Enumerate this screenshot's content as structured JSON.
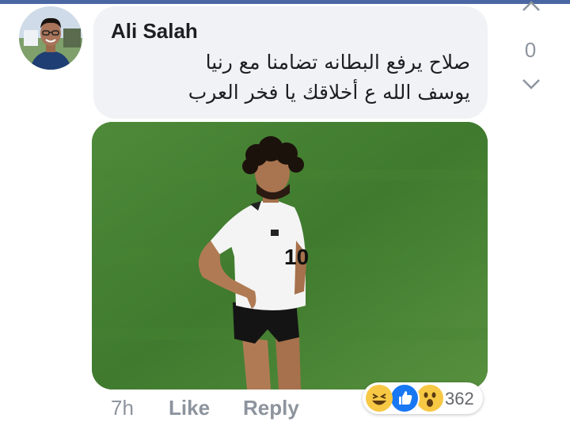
{
  "comment": {
    "author": "Ali Salah",
    "lines": [
      "صلاح يرفع البطانه تضامنا مع رنيا",
      "يوسف الله ع أخلاقك يا فخر العرب"
    ],
    "vote_count": "0"
  },
  "photo": {
    "jersey_number": "10"
  },
  "actions": {
    "time": "7h",
    "like_label": "Like",
    "reply_label": "Reply"
  },
  "reactions": {
    "types": [
      "haha-icon",
      "like-icon",
      "wow-icon"
    ],
    "count": "362"
  },
  "colors": {
    "brand_bar": "#4a67a3",
    "bubble": "#f0f2f5",
    "muted_text": "#8d949e",
    "like_blue": "#1877f2",
    "emoji_yellow": "#f7c844",
    "grass": "#3f7a2e"
  }
}
